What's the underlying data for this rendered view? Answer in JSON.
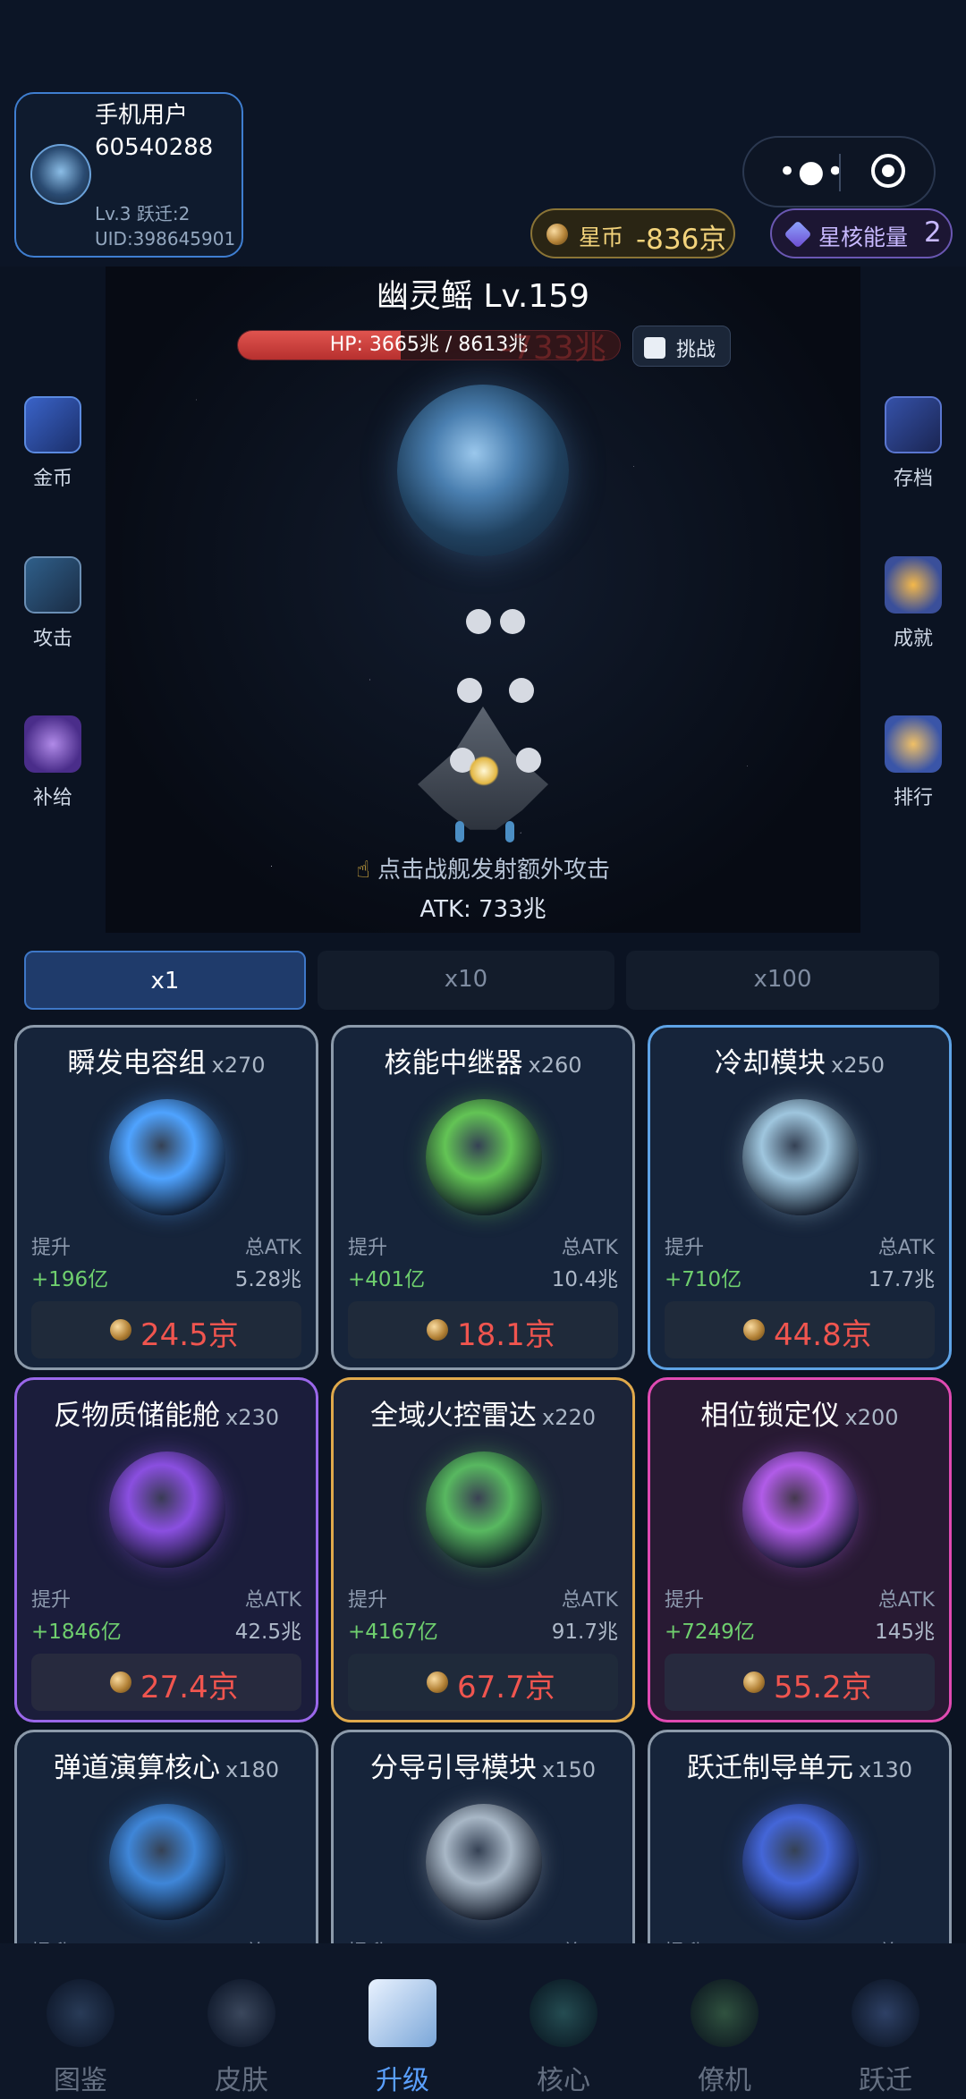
{
  "user": {
    "name": "手机用户60540288",
    "level": "Lv.3 跃迁:2",
    "uid": "UID:398645901"
  },
  "currency": {
    "coin_label": "星币",
    "coin_value": "-836京",
    "core_label": "星核能量",
    "core_value": "2"
  },
  "battle": {
    "boss_name": "幽灵鳐 Lv.159",
    "hp_text": "HP: 3665兆 / 8613兆",
    "hp_ratio": 0.4255,
    "floating_damage": "-733兆",
    "challenge_label": "挑战",
    "hint": "点击战舰发射额外攻击",
    "atk": "ATK: 733兆"
  },
  "side_left": [
    {
      "label": "金币",
      "icon": "gold-coin-icon"
    },
    {
      "label": "攻击",
      "icon": "crossed-swords-icon"
    },
    {
      "label": "补给",
      "icon": "supply-cube-icon"
    }
  ],
  "side_right": [
    {
      "label": "存档",
      "icon": "save-icon"
    },
    {
      "label": "成就",
      "icon": "trophy-icon"
    },
    {
      "label": "排行",
      "icon": "ranking-icon"
    }
  ],
  "multipliers": [
    "x1",
    "x10",
    "x100"
  ],
  "multiplier_active": "x1",
  "upgrades": [
    {
      "name": "瞬发电容组",
      "count": "x270",
      "up_label": "提升",
      "atk_label": "总ATK",
      "gain": "+196亿",
      "total": "5.28兆",
      "cost": "24.5京",
      "color": "#4fa3ff"
    },
    {
      "name": "核能中继器",
      "count": "x260",
      "up_label": "提升",
      "atk_label": "总ATK",
      "gain": "+401亿",
      "total": "10.4兆",
      "cost": "18.1京",
      "color": "#63c455"
    },
    {
      "name": "冷却模块",
      "count": "x250",
      "up_label": "提升",
      "atk_label": "总ATK",
      "gain": "+710亿",
      "total": "17.7兆",
      "cost": "44.8京",
      "color": "#9fc6de"
    },
    {
      "name": "反物质储能舱",
      "count": "x230",
      "up_label": "提升",
      "atk_label": "总ATK",
      "gain": "+1846亿",
      "total": "42.5兆",
      "cost": "27.4京",
      "color": "#8a4fe0"
    },
    {
      "name": "全域火控雷达",
      "count": "x220",
      "up_label": "提升",
      "atk_label": "总ATK",
      "gain": "+4167亿",
      "total": "91.7兆",
      "cost": "67.7京",
      "color": "#58b860"
    },
    {
      "name": "相位锁定仪",
      "count": "x200",
      "up_label": "提升",
      "atk_label": "总ATK",
      "gain": "+7249亿",
      "total": "145兆",
      "cost": "55.2京",
      "color": "#b15ce8"
    },
    {
      "name": "弹道演算核心",
      "count": "x180",
      "up_label": "提升",
      "atk_label": "总ATK",
      "gain": "",
      "total": "",
      "cost": "",
      "color": "#3f86d8"
    },
    {
      "name": "分导引导模块",
      "count": "x150",
      "up_label": "提升",
      "atk_label": "总ATK",
      "gain": "",
      "total": "",
      "cost": "",
      "color": "#a8b7c6"
    },
    {
      "name": "跃迁制导单元",
      "count": "x130",
      "up_label": "提升",
      "atk_label": "总ATK",
      "gain": "",
      "total": "",
      "cost": "",
      "color": "#4466d8"
    }
  ],
  "nav": [
    {
      "label": "图鉴",
      "icon": "codex-icon"
    },
    {
      "label": "皮肤",
      "icon": "skin-icon"
    },
    {
      "label": "升级",
      "icon": "upgrade-icon"
    },
    {
      "label": "核心",
      "icon": "core-icon"
    },
    {
      "label": "僚机",
      "icon": "wingman-icon"
    },
    {
      "label": "跃迁",
      "icon": "warp-icon"
    }
  ],
  "nav_active": "升级"
}
